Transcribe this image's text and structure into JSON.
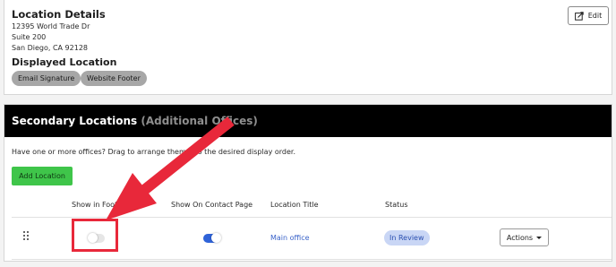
{
  "location_details": {
    "title": "Location Details",
    "address_line1": "12395 World Trade Dr",
    "address_line2": "Suite 200",
    "address_line3": "San Diego, CA 92128",
    "edit_label": "Edit"
  },
  "displayed_location": {
    "title": "Displayed Location",
    "chips": [
      "Email Signature",
      "Website Footer"
    ]
  },
  "secondary": {
    "title": "Secondary Locations",
    "subtitle": "(Additional Offices)",
    "help_text": "Have one or more offices? Drag to arrange them into the desired display order.",
    "add_label": "Add Location",
    "columns": [
      "Show in Footer",
      "Show On Contact Page",
      "Location Title",
      "Status"
    ],
    "rows": [
      {
        "show_in_footer": false,
        "show_on_contact_page": true,
        "location_title": "Main office",
        "status": "In Review",
        "actions_label": "Actions"
      }
    ]
  },
  "colors": {
    "accent_blue": "#2f63d8",
    "add_button_green": "#3fc54a",
    "annotation_red": "#e8283a",
    "header_black": "#000000"
  },
  "icons": {
    "edit": "external-edit-icon",
    "drag": "drag-handle-icon",
    "actions": "chevron-down-icon"
  }
}
